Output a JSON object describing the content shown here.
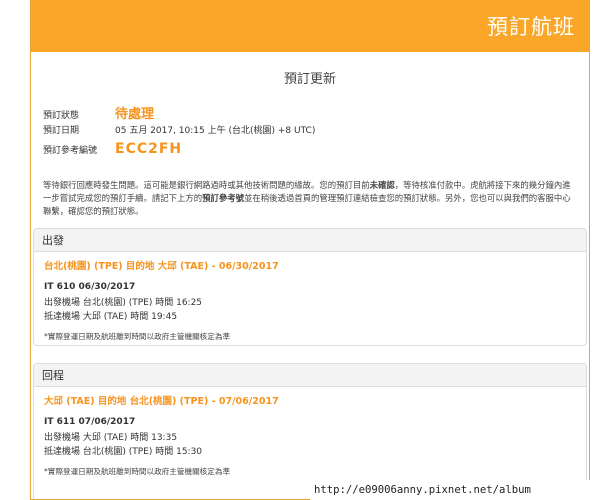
{
  "header": {
    "title": "預訂航班"
  },
  "page": {
    "section_title": "預訂更新"
  },
  "booking": {
    "status_label": "預訂狀態",
    "status_value": "待處理",
    "date_label": "預訂日期",
    "date_value": "05 五月 2017, 10:15 上午 (台北(桃園) +8 UTC)",
    "ref_label": "預訂參考編號",
    "ref_value": "ECC2FH"
  },
  "notice": {
    "p1": "等待銀行回應時發生問題。這可能是銀行網路過時或其他技術問題的緣故。您的預訂目前",
    "b1": "未確認",
    "p2": "，等待核准付款中。虎航將接下來的幾分鐘內進一步嘗試完成您的預訂手續。請記下上方的",
    "b2": "預訂參考號",
    "p3": "並在稍後透過首頁的管理預訂連結檢查您的預訂狀態。另外，您也可以與我們的客服中心聯繫，確認您的預訂狀態。"
  },
  "outbound": {
    "heading": "出發",
    "route": "台北(桃園) (TPE) 目的地 大邱 (TAE) - 06/30/2017",
    "flight": "IT 610  06/30/2017",
    "depart": "出發機場 台北(桃園) (TPE) 時間 16:25",
    "arrive": "抵達機場 大邱 (TAE) 時間 19:45",
    "note": "*實際登運日期及航班離到時間以政府主管機關核定為準"
  },
  "return": {
    "heading": "回程",
    "route": "大邱 (TAE) 目的地 台北(桃園) (TPE) - 07/06/2017",
    "flight": "IT 611  07/06/2017",
    "depart": "出發機場 大邱 (TAE) 時間 13:35",
    "arrive": "抵達機場 台北(桃園) (TPE) 時間 15:30",
    "note": "*實際登運日期及航班離到時間以政府主管機關核定為準"
  },
  "watermark": {
    "text": "http://e09006anny.pixnet.net/album"
  },
  "colors": {
    "header": "#f9a629",
    "accent": "#f7941d",
    "panel": "#f3f3f3"
  }
}
